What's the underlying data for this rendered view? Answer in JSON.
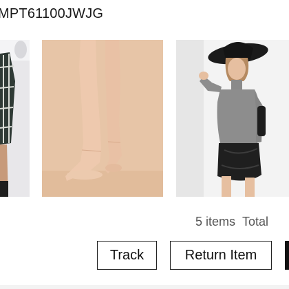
{
  "order": {
    "number": "MPT61100JWJG"
  },
  "products": [
    {
      "name": "plaid-skirt-product-image"
    },
    {
      "name": "sheer-tights-product-image"
    },
    {
      "name": "turtleneck-and-leather-skirt-product-image"
    }
  ],
  "summary": {
    "items": "5 items",
    "total": "Total"
  },
  "actions": {
    "track": "Track",
    "return_item": "Return Item"
  },
  "colors": {
    "border": "#222222",
    "summary_text": "#555555",
    "tights_bg": "#e6c3a4"
  }
}
